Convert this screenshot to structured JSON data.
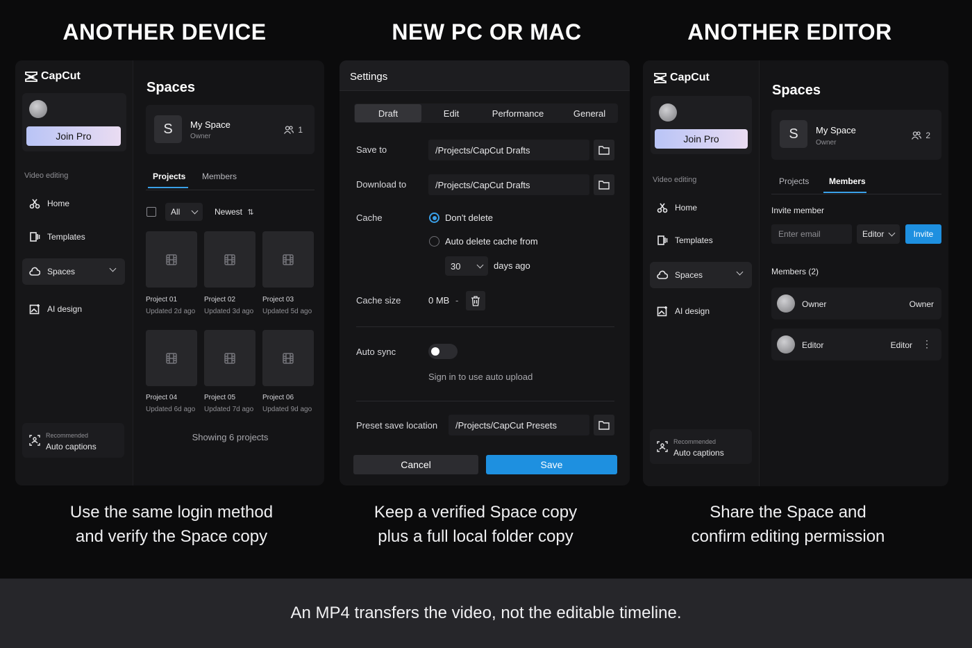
{
  "headings": [
    "ANOTHER DEVICE",
    "NEW PC OR MAC",
    "ANOTHER EDITOR"
  ],
  "captions": {
    "left": [
      "Use the same login method",
      "and verify the Space copy"
    ],
    "center": [
      "Keep a verified Space copy",
      "plus a full local folder copy"
    ],
    "right": [
      "Share the Space and",
      "confirm editing permission"
    ]
  },
  "footer": "An MP4 transfers the video, not the editable timeline.",
  "app": {
    "brand": "CapCut",
    "join_pro": "Join Pro",
    "section_label": "Video editing",
    "nav": [
      {
        "label": "Home",
        "icon": "home-icon"
      },
      {
        "label": "Templates",
        "icon": "templates-icon"
      },
      {
        "label": "Spaces",
        "icon": "cloud-icon"
      },
      {
        "label": "AI design",
        "icon": "ai-design-icon"
      }
    ],
    "recommended": {
      "small": "Recommended",
      "label": "Auto captions"
    },
    "spaces_title": "Spaces",
    "space": {
      "initial": "S",
      "name": "My Space",
      "role": "Owner"
    },
    "tabs": [
      "Projects",
      "Members"
    ]
  },
  "device": {
    "member_count": "1",
    "filter": {
      "all": "All",
      "sort": "Newest"
    },
    "projects": [
      {
        "title": "Project 01",
        "updated": "Updated 2d ago"
      },
      {
        "title": "Project 02",
        "updated": "Updated 3d ago"
      },
      {
        "title": "Project 03",
        "updated": "Updated 5d ago"
      },
      {
        "title": "Project 04",
        "updated": "Updated 6d ago"
      },
      {
        "title": "Project 05",
        "updated": "Updated 7d ago"
      },
      {
        "title": "Project 06",
        "updated": "Updated 9d ago"
      }
    ],
    "showing": "Showing 6 projects"
  },
  "settings": {
    "title": "Settings",
    "tabs": [
      "Draft",
      "Edit",
      "Performance",
      "General"
    ],
    "save_to": {
      "label": "Save to",
      "value": "/Projects/CapCut Drafts"
    },
    "download_to": {
      "label": "Download to",
      "value": "/Projects/CapCut Drafts"
    },
    "cache": {
      "label": "Cache",
      "option_keep": "Don't delete",
      "option_auto": "Auto delete cache from",
      "days": "30",
      "days_suffix": "days ago"
    },
    "cache_size": {
      "label": "Cache size",
      "value": "0 MB",
      "sep": "-"
    },
    "auto_sync": {
      "label": "Auto sync",
      "hint": "Sign in to use auto upload"
    },
    "preset": {
      "label": "Preset save location",
      "value": "/Projects/CapCut Presets"
    },
    "cancel": "Cancel",
    "save": "Save"
  },
  "editor": {
    "member_count": "2",
    "invite_label": "Invite member",
    "email_placeholder": "Enter email",
    "role_select": "Editor",
    "invite_button": "Invite",
    "members_heading": "Members (2)",
    "members": [
      {
        "name": "Owner",
        "role": "Owner"
      },
      {
        "name": "Editor",
        "role": "Editor"
      }
    ]
  }
}
